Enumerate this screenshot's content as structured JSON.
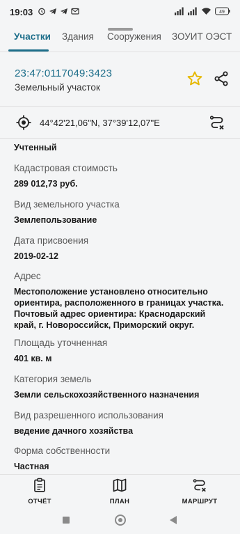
{
  "status_bar": {
    "time": "19:03",
    "battery": "49"
  },
  "tabs": [
    {
      "label": "Участки",
      "active": true
    },
    {
      "label": "Здания",
      "active": false
    },
    {
      "label": "Сооружения",
      "active": false
    },
    {
      "label": "ЗОУИТ ОЭСТ",
      "active": false
    }
  ],
  "header": {
    "cadastral_number": "23:47:0117049:3423",
    "object_type": "Земельный участок"
  },
  "coordinates": {
    "text": "44°42'21,06\"N, 37°39'12,07\"E"
  },
  "fields": [
    {
      "label": "",
      "value": "Учтенный"
    },
    {
      "label": "Кадастровая стоимость",
      "value": "289 012,73 руб."
    },
    {
      "label": "Вид земельного участка",
      "value": "Землепользование"
    },
    {
      "label": "Дата присвоения",
      "value": "2019-02-12"
    },
    {
      "label": "Адрес",
      "value": "Местоположение установлено относительно ориентира, расположенного в границах участка. Почтовый адрес ориентира: Краснодарский край, г. Новороссийск, Приморский округ."
    },
    {
      "label": "Площадь уточненная",
      "value": "401 кв. м"
    },
    {
      "label": "Категория земель",
      "value": "Земли сельскохозяйственного назначения"
    },
    {
      "label": "Вид разрешенного использования",
      "value": "ведение дачного хозяйства"
    },
    {
      "label": "Форма собственности",
      "value": "Частная"
    }
  ],
  "bottom_nav": {
    "report": "ОТЧЁТ",
    "plan": "ПЛАН",
    "route": "МАРШРУТ"
  },
  "colors": {
    "accent": "#1d6e8a",
    "star": "#e6b800",
    "background": "#f4f5f6"
  }
}
